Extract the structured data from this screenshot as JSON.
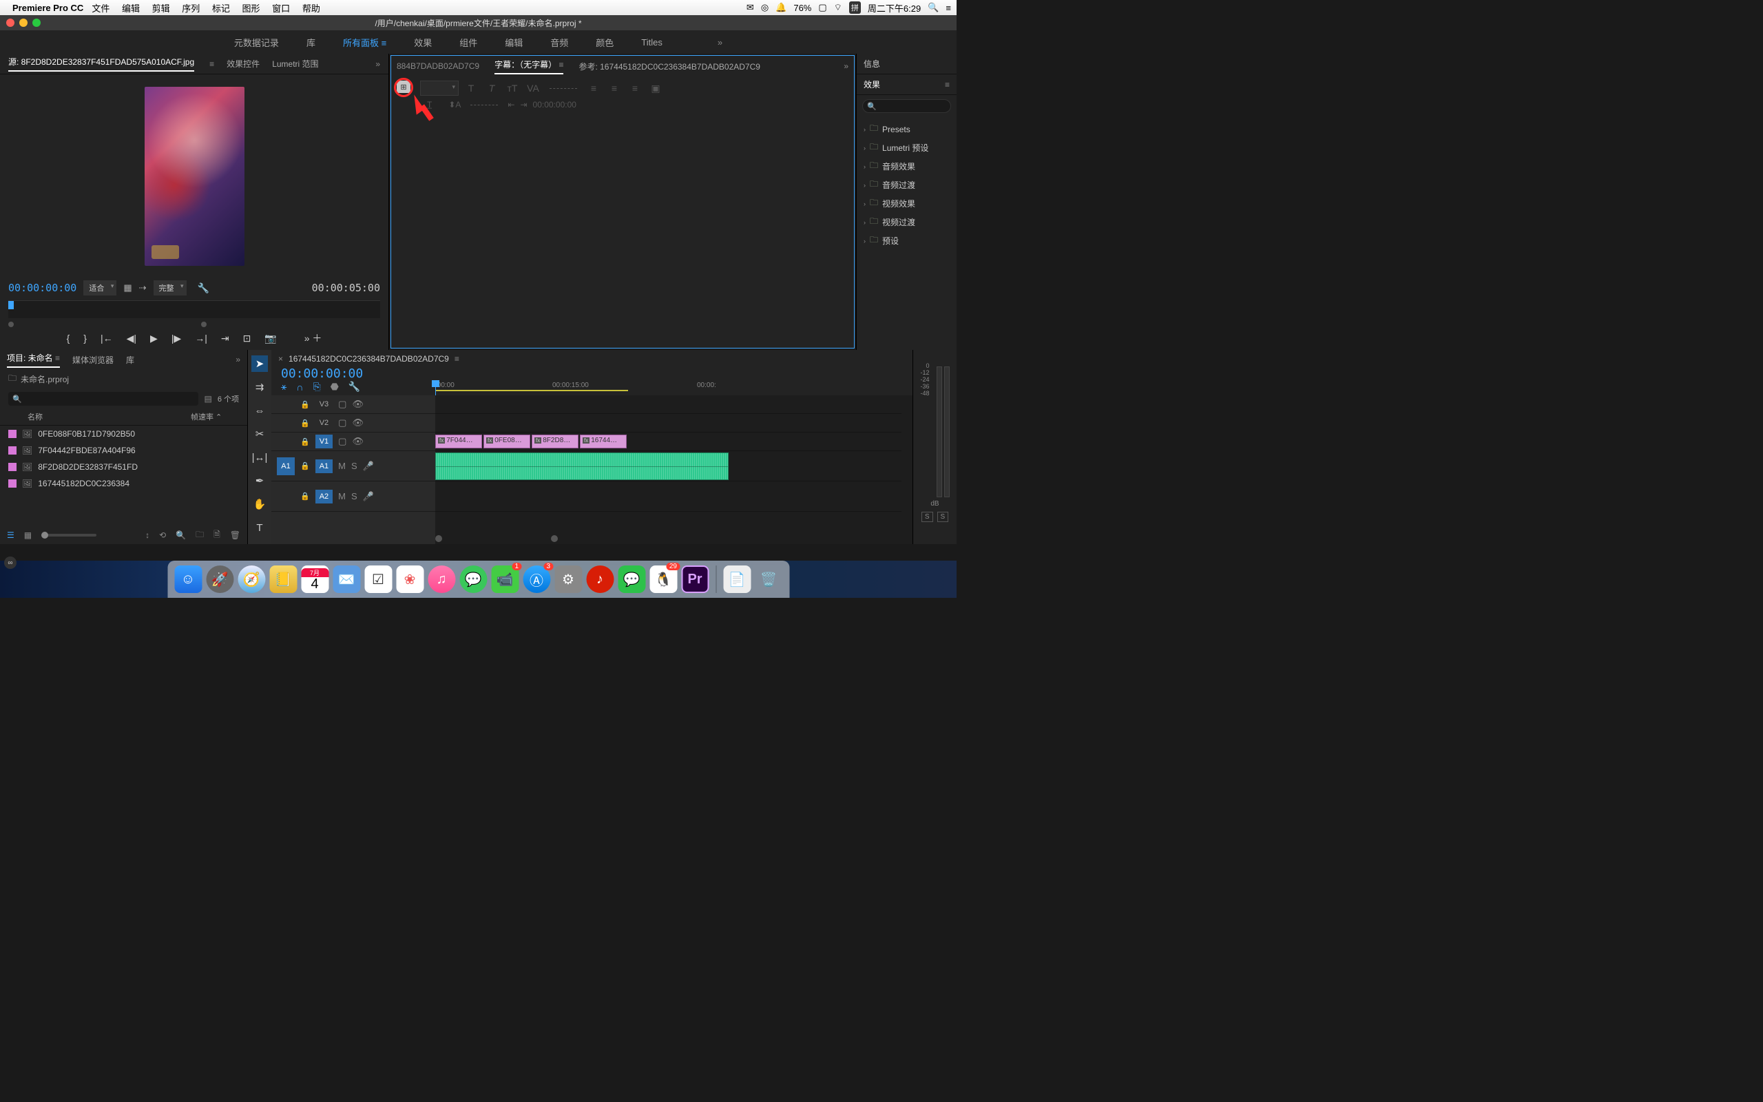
{
  "menubar": {
    "app": "Premiere Pro CC",
    "menus": [
      "文件",
      "编辑",
      "剪辑",
      "序列",
      "标记",
      "图形",
      "窗口",
      "帮助"
    ],
    "battery": "76%",
    "ime": "拼",
    "clock": "周二下午6:29"
  },
  "window_title": "/用户/chenkai/桌面/prmiere文件/王者荣耀/未命名.prproj *",
  "workspaces": [
    "元数据记录",
    "库",
    "所有面板",
    "效果",
    "组件",
    "编辑",
    "音频",
    "颜色",
    "Titles"
  ],
  "workspace_active": "所有面板",
  "source": {
    "tabs": {
      "source": "源: 8F2D8D2DE32837F451FDAD575A010ACF.jpg",
      "fx": "效果控件",
      "lumetri": "Lumetri 范围"
    },
    "timecode": "00:00:00:00",
    "fit": "适合",
    "quality": "完整",
    "duration": "00:00:05:00"
  },
  "caption": {
    "overflow_tab": "884B7DADB02AD7C9",
    "tab_active": "字幕：（无字幕）",
    "ref": "参考: 167445182DC0C236384B7DADB02AD7C9",
    "timecode": "00:00:00:00"
  },
  "effects_panel": {
    "info": "信息",
    "title": "效果",
    "items": [
      "Presets",
      "Lumetri 预设",
      "音频效果",
      "音频过渡",
      "视频效果",
      "视频过渡",
      "预设"
    ]
  },
  "project": {
    "tabs": {
      "project": "项目: 未命名",
      "browser": "媒体浏览器",
      "lib": "库"
    },
    "bin": "未命名.prproj",
    "count": "6 个项",
    "col_name": "名称",
    "col_rate": "帧速率",
    "rows": [
      "0FE088F0B171D7902B50",
      "7F04442FBDE87A404F96",
      "8F2D8D2DE32837F451FD",
      "167445182DC0C236384"
    ]
  },
  "timeline": {
    "seq": "167445182DC0C236384B7DADB02AD7C9",
    "timecode": "00:00:00:00",
    "ruler": {
      "t0": ":00:00",
      "t1": "00:00:15:00",
      "t2": "00:00:"
    },
    "tracks": {
      "v3": "V3",
      "v2": "V2",
      "v1": "V1",
      "a1": "A1",
      "a2": "A2"
    },
    "clips": [
      "7F044…",
      "0FE08…",
      "8F2D8…",
      "16744…"
    ],
    "head_labels": {
      "m": "M",
      "s": "S"
    }
  },
  "meters": {
    "labels": [
      "0",
      "-12",
      "-24",
      "-36",
      "-48"
    ],
    "unit": "dB",
    "solo": "S"
  },
  "dock": {
    "cal_month": "7月",
    "cal_day": "4",
    "pr": "Pr",
    "facetime_badge": "1",
    "appstore_badge": "3",
    "qq_badge": "29"
  }
}
